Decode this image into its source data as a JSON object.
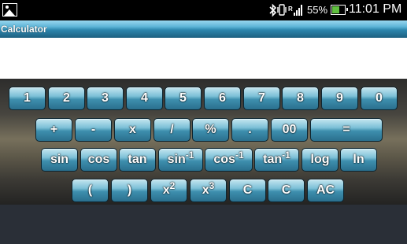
{
  "status_bar": {
    "battery_percent": "55%",
    "time": "11:01 PM",
    "icons": [
      "gallery-icon",
      "bluetooth-icon",
      "vibrate-icon",
      "signal-icon",
      "battery-icon"
    ]
  },
  "app": {
    "title": "Calculator",
    "display_value": ""
  },
  "keys": {
    "row1": [
      "1",
      "2",
      "3",
      "4",
      "5",
      "6",
      "7",
      "8",
      "9",
      "0"
    ],
    "row2": [
      "+",
      "-",
      "x",
      "/",
      "%",
      ".",
      "00",
      "="
    ],
    "row3": [
      "sin",
      "cos",
      "tan",
      "sin",
      "cos",
      "tan",
      "log",
      "ln"
    ],
    "row3_sup": [
      "-1",
      "-1",
      "-1"
    ],
    "row4": [
      "(",
      ")",
      "x",
      "x",
      "C",
      "C",
      "AC"
    ],
    "row4_sup": [
      "2",
      "3"
    ]
  }
}
